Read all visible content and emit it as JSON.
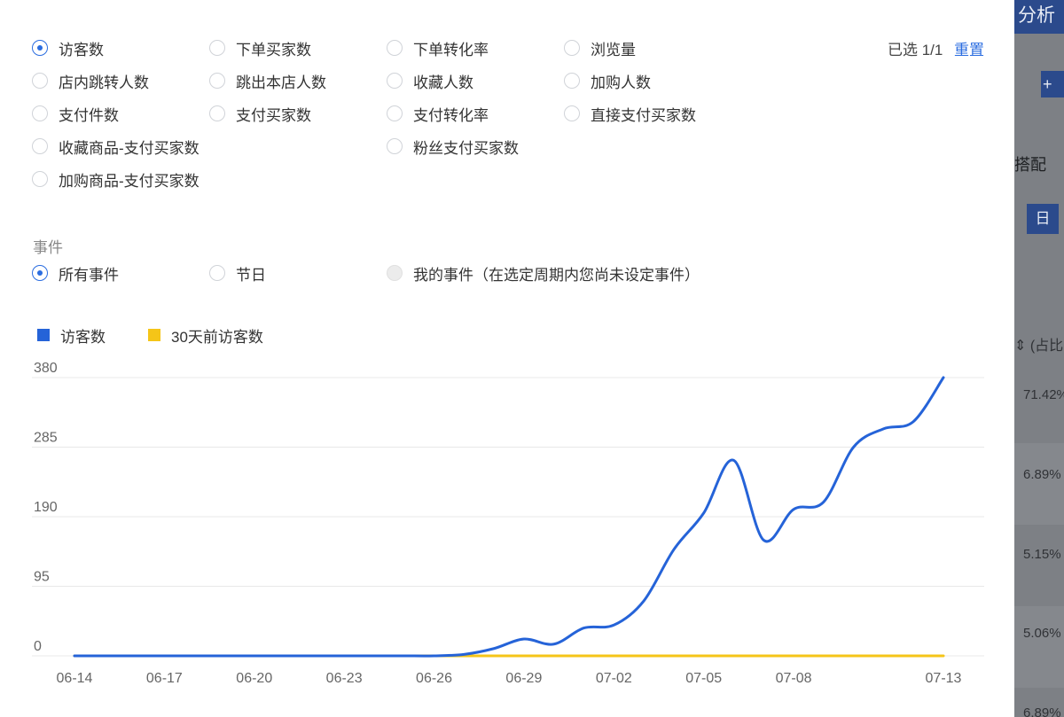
{
  "background": {
    "title": "分析",
    "add_button": "+",
    "tab_label": "搭配",
    "day_button": "日",
    "column_header": "⇕ (占比",
    "percents": [
      "71.42%",
      "6.89%",
      "5.15%",
      "5.06%",
      "6.89%"
    ]
  },
  "metrics": {
    "selected_count": "已选 1/1",
    "reset_label": "重置",
    "items": [
      {
        "label": "访客数",
        "checked": true
      },
      {
        "label": "下单买家数",
        "checked": false
      },
      {
        "label": "下单转化率",
        "checked": false
      },
      {
        "label": "浏览量",
        "checked": false
      },
      {
        "label": "店内跳转人数",
        "checked": false
      },
      {
        "label": "跳出本店人数",
        "checked": false
      },
      {
        "label": "收藏人数",
        "checked": false
      },
      {
        "label": "加购人数",
        "checked": false
      },
      {
        "label": "支付件数",
        "checked": false
      },
      {
        "label": "支付买家数",
        "checked": false
      },
      {
        "label": "支付转化率",
        "checked": false
      },
      {
        "label": "直接支付买家数",
        "checked": false
      },
      {
        "label": "收藏商品-支付买家数",
        "checked": false
      },
      {
        "label": "粉丝支付买家数",
        "checked": false
      },
      {
        "label": "加购商品-支付买家数",
        "checked": false
      }
    ]
  },
  "events": {
    "section_label": "事件",
    "items": [
      {
        "label": "所有事件",
        "checked": true,
        "disabled": false
      },
      {
        "label": "节日",
        "checked": false,
        "disabled": false
      },
      {
        "label": "我的事件（在选定周期内您尚未设定事件）",
        "checked": false,
        "disabled": true
      }
    ]
  },
  "colors": {
    "accent": "#2b6de0",
    "series_visitors": "#2563d8",
    "series_prev": "#f5c518",
    "grid": "#e8e8e8"
  },
  "chart_data": {
    "type": "line",
    "x": [
      "06-14",
      "06-15",
      "06-16",
      "06-17",
      "06-18",
      "06-19",
      "06-20",
      "06-21",
      "06-22",
      "06-23",
      "06-24",
      "06-25",
      "06-26",
      "06-27",
      "06-28",
      "06-29",
      "06-30",
      "07-01",
      "07-02",
      "07-03",
      "07-04",
      "07-05",
      "07-06",
      "07-07",
      "07-08",
      "07-09",
      "07-10",
      "07-11",
      "07-12",
      "07-13"
    ],
    "x_tick_labels": [
      "06-14",
      "06-17",
      "06-20",
      "06-23",
      "06-26",
      "06-29",
      "07-02",
      "07-05",
      "07-08",
      "07-13"
    ],
    "yticks": [
      0,
      95,
      190,
      285,
      380
    ],
    "ylim": [
      0,
      380
    ],
    "grid": true,
    "legend": "top-left",
    "series": [
      {
        "name": "访客数",
        "color": "#2563d8",
        "values": [
          0,
          0,
          0,
          0,
          0,
          0,
          0,
          0,
          0,
          0,
          0,
          0,
          0,
          2,
          10,
          23,
          16,
          38,
          42,
          75,
          145,
          195,
          267,
          158,
          200,
          210,
          285,
          310,
          320,
          380
        ]
      },
      {
        "name": "30天前访客数",
        "color": "#f5c518",
        "values": [
          0,
          0,
          0,
          0,
          0,
          0,
          0,
          0,
          0,
          0,
          0,
          0,
          0,
          0,
          0,
          0,
          0,
          0,
          0,
          0,
          0,
          0,
          0,
          0,
          0,
          0,
          0,
          0,
          0,
          0
        ]
      }
    ]
  }
}
